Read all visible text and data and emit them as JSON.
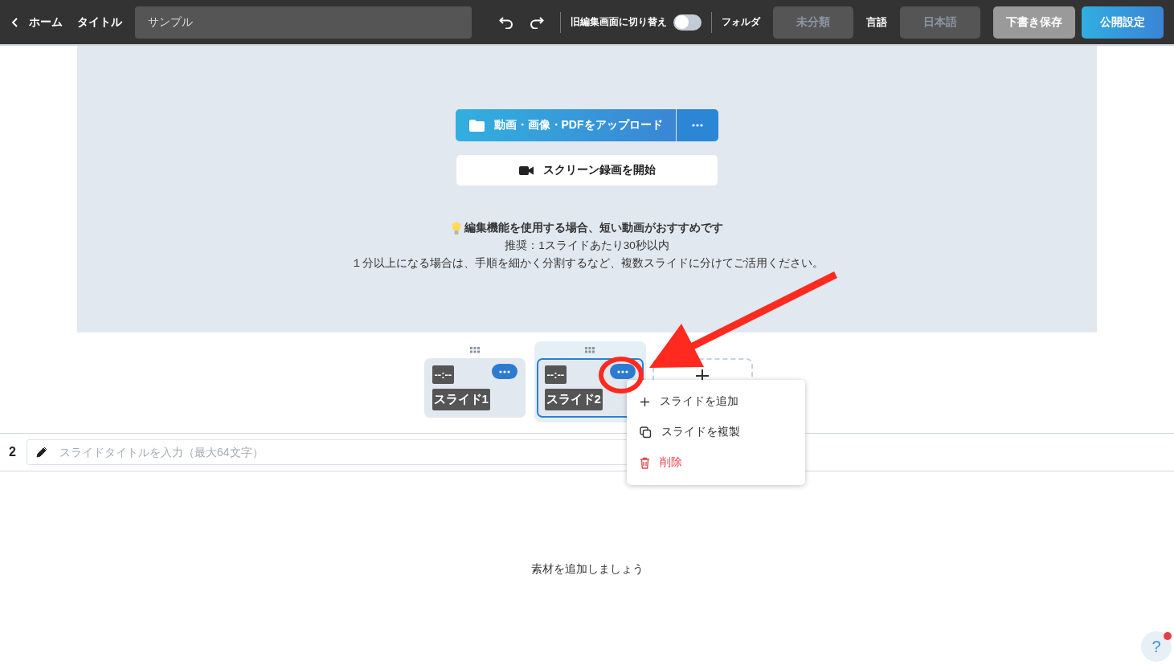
{
  "topbar": {
    "back_label": "ホーム",
    "title_label": "タイトル",
    "title_value": "サンプル",
    "old_editor_label": "旧編集画面に切り替え",
    "old_editor_on": false,
    "folder_label": "フォルダ",
    "folder_value": "未分類",
    "language_label": "言語",
    "language_value": "日本語",
    "draft_button": "下書き保存",
    "publish_button": "公開設定"
  },
  "upload": {
    "upload_button": "動画・画像・PDFをアップロード",
    "record_button": "スクリーン録画を開始",
    "tip_heading": "編集機能を使用する場合、短い動画がおすすめです",
    "tip_lines": [
      "推奨：1スライドあたり30秒以内",
      "１分以上になる場合は、手順を細かく分割するなど、複数スライドに分けてご活用ください。"
    ]
  },
  "slides": [
    {
      "time": "--:--",
      "label": "スライド1",
      "selected": false
    },
    {
      "time": "--:--",
      "label": "スライド2",
      "selected": true
    }
  ],
  "slide_menu": [
    {
      "kind": "add",
      "label": "スライドを追加"
    },
    {
      "kind": "duplicate",
      "label": "スライドを複製"
    },
    {
      "kind": "delete",
      "label": "削除"
    }
  ],
  "slide_title": {
    "number": "2",
    "placeholder": "スライドタイトルを入力（最大64文字）"
  },
  "empty_message": "素材を追加しましょう",
  "help": {
    "label": "?",
    "has_notification": true
  }
}
